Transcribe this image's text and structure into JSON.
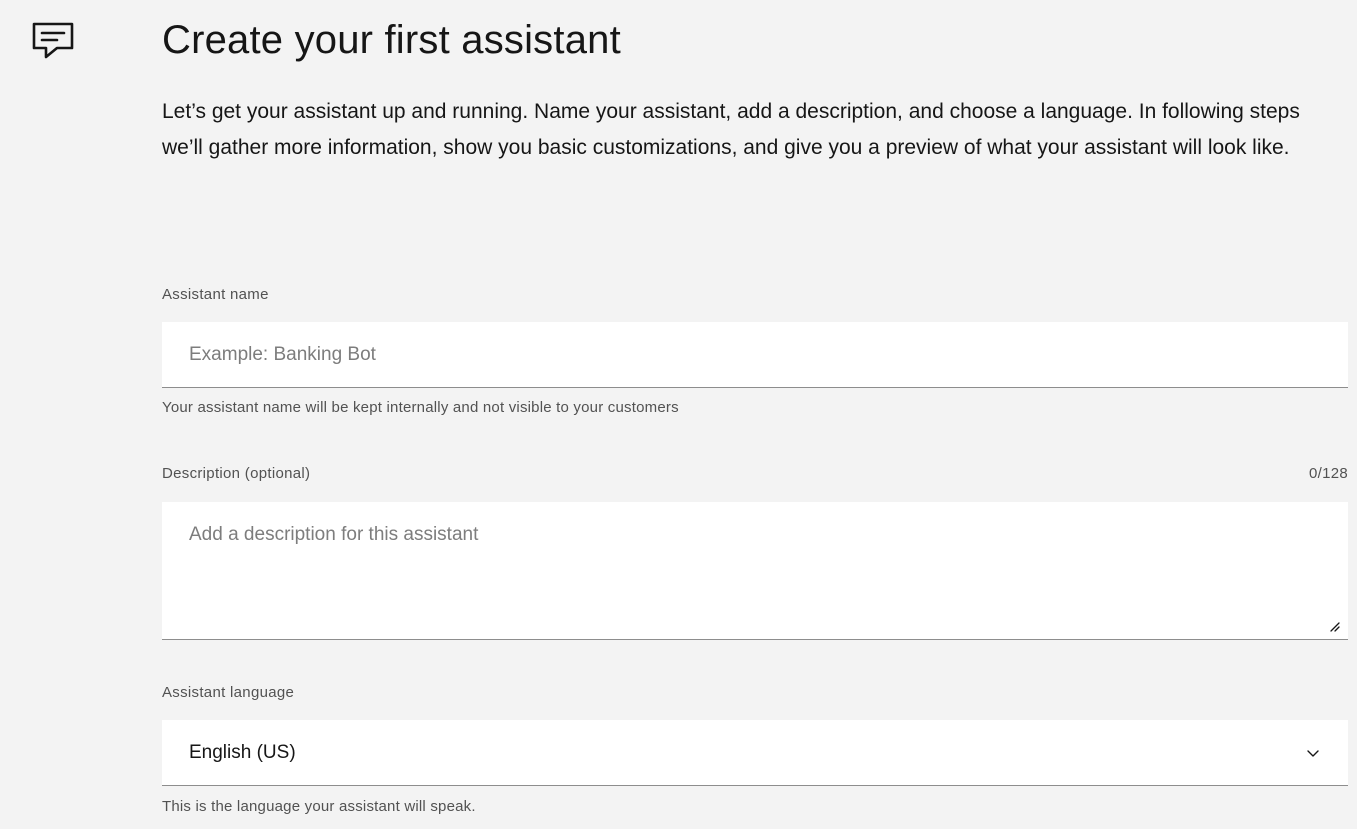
{
  "header": {
    "icon": "chat-icon",
    "title": "Create your first assistant",
    "intro": "Let’s get your assistant up and running. Name your assistant, add a description, and choose a language. In following steps we’ll gather more information, show you basic customizations, and give you a preview of what your assistant will look like."
  },
  "form": {
    "name": {
      "label": "Assistant name",
      "value": "",
      "placeholder": "Example: Banking Bot",
      "helper": "Your assistant name will be kept internally and not visible to your customers"
    },
    "description": {
      "label": "Description (optional)",
      "counter": "0/128",
      "value": "",
      "placeholder": "Add a description for this assistant",
      "resize_icon": "resize-handle-icon"
    },
    "language": {
      "label": "Assistant language",
      "selected": "English (US)",
      "dropdown_icon": "chevron-down-icon",
      "helper": "This is the language your assistant will speak."
    }
  }
}
